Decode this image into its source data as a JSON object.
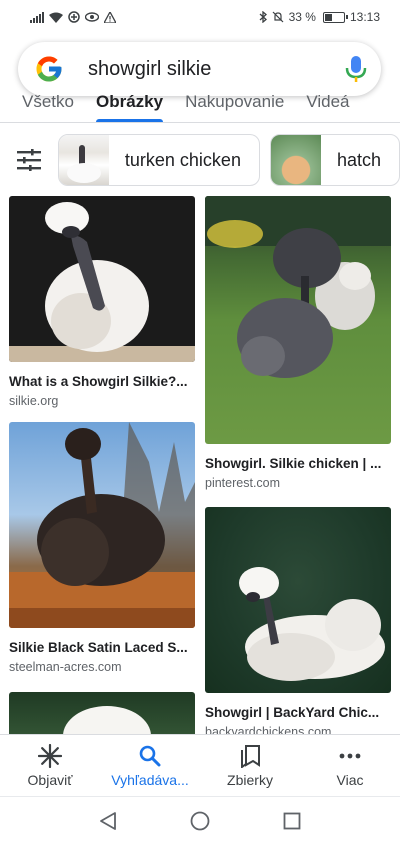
{
  "status_bar": {
    "battery_percent": "33 %",
    "battery_level": 0.33,
    "time": "13:13",
    "icons": [
      "signal-icon",
      "wifi-icon",
      "data-saver-icon",
      "eye-comfort-icon",
      "warning-icon",
      "bluetooth-icon",
      "mute-icon",
      "battery-icon"
    ]
  },
  "search": {
    "query": "showgirl silkie",
    "icons": [
      "google-logo-icon",
      "mic-icon"
    ]
  },
  "tabs": [
    {
      "label": "Všetko",
      "active": false
    },
    {
      "label": "Obrázky",
      "active": true
    },
    {
      "label": "Nakupovanie",
      "active": false
    },
    {
      "label": "Videá",
      "active": false
    }
  ],
  "chips": [
    {
      "label": "turken chicken"
    },
    {
      "label": "hatch"
    }
  ],
  "results": [
    {
      "caption": "What is a Showgirl Silkie?...",
      "source": "silkie.org"
    },
    {
      "caption": "Showgirl. Silkie chicken | ...",
      "source": "pinterest.com"
    },
    {
      "caption": "Silkie Black Satin Laced S...",
      "source": "steelman-acres.com"
    },
    {
      "caption": "Showgirl | BackYard Chic...",
      "source": "backyardchickens.com"
    }
  ],
  "bottom_nav": [
    {
      "label": "Objaviť",
      "icon": "asterisk-icon",
      "active": false
    },
    {
      "label": "Vyhľadáva...",
      "icon": "search-icon",
      "active": true
    },
    {
      "label": "Zbierky",
      "icon": "collections-icon",
      "active": false
    },
    {
      "label": "Viac",
      "icon": "more-icon",
      "active": false
    }
  ],
  "colors": {
    "accent": "#1a73e8",
    "text": "#202124",
    "secondary_text": "#5f6368"
  }
}
